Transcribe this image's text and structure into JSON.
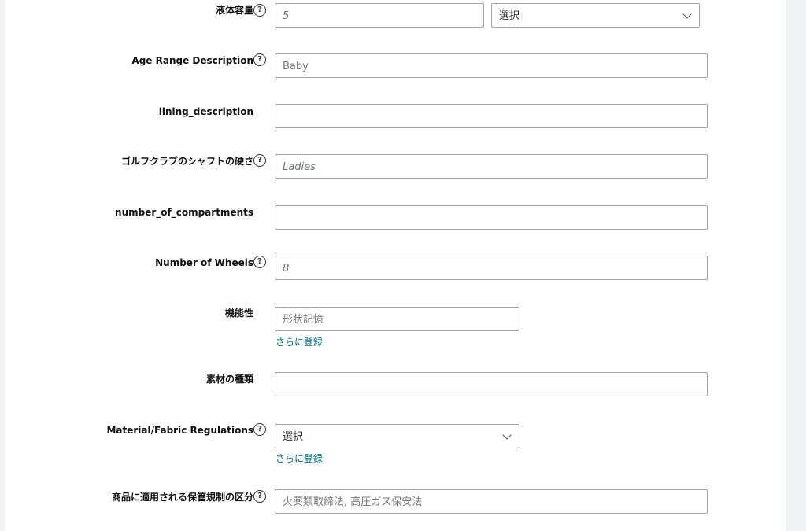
{
  "fields": [
    {
      "label": "液体容量",
      "value": "5",
      "unit_select": "選択"
    },
    {
      "label": "Age Range Description",
      "value": "Baby"
    },
    {
      "label": "lining_description",
      "value": ""
    },
    {
      "label": "ゴルフクラブのシャフトの硬さ",
      "value": "Ladies"
    },
    {
      "label": "number_of_compartments",
      "value": ""
    },
    {
      "label": "Number of Wheels",
      "value": "8"
    },
    {
      "label": "機能性",
      "value": "形状記憶",
      "more_link": "さらに登録"
    },
    {
      "label": "素材の種類",
      "value": ""
    },
    {
      "label": "Material/Fabric Regulations",
      "select_value": "選択",
      "more_link": "さらに登録"
    },
    {
      "label": "商品に適用される保管規制の区分",
      "value": "火薬類取締法, 高圧ガス保安法"
    }
  ],
  "help_icon_glyph": "?"
}
